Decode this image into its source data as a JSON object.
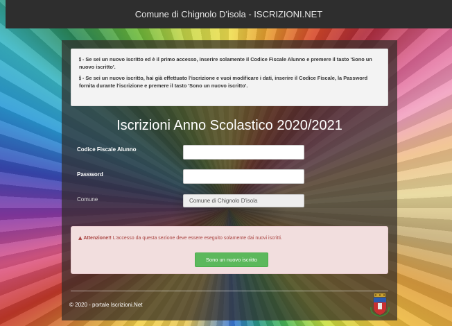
{
  "header": {
    "title": "Comune di Chignolo D'isola - ISCRIZIONI.NET"
  },
  "info": {
    "icon": "info-icon",
    "line1": "- Se sei un nuovo iscritto ed è il primo accesso, inserire solamente il Codice Fiscale Alunno e premere il tasto 'Sono un nuovo iscritto'.",
    "line2": "- Se sei un nuovo iscritto, hai già effettuato l'iscrizione e vuoi modificare i dati, inserire il Codice Fiscale, la Password fornita durante l'iscrizione e premere il tasto 'Sono un nuovo iscritto'."
  },
  "form": {
    "title": "Iscrizioni Anno Scolastico 2020/2021",
    "codice_fiscale_label": "Codice Fiscale Alunno",
    "codice_fiscale_value": "",
    "password_label": "Password",
    "password_value": "",
    "comune_label": "Comune",
    "comune_value": "Comune di Chignolo D'isola"
  },
  "alert": {
    "icon": "warning-icon",
    "strong": "Attenzione!!",
    "text": " L'accesso da questa sezione deve essere eseguito solamente dai nuovi iscritti.",
    "button_label": "Sono un nuovo iscritto",
    "color": "#a94442",
    "button_color": "#5cb85c"
  },
  "footer": {
    "text": "© 2020 - portale Iscrizioni.Net",
    "crest_icon": "municipal-crest-icon"
  }
}
